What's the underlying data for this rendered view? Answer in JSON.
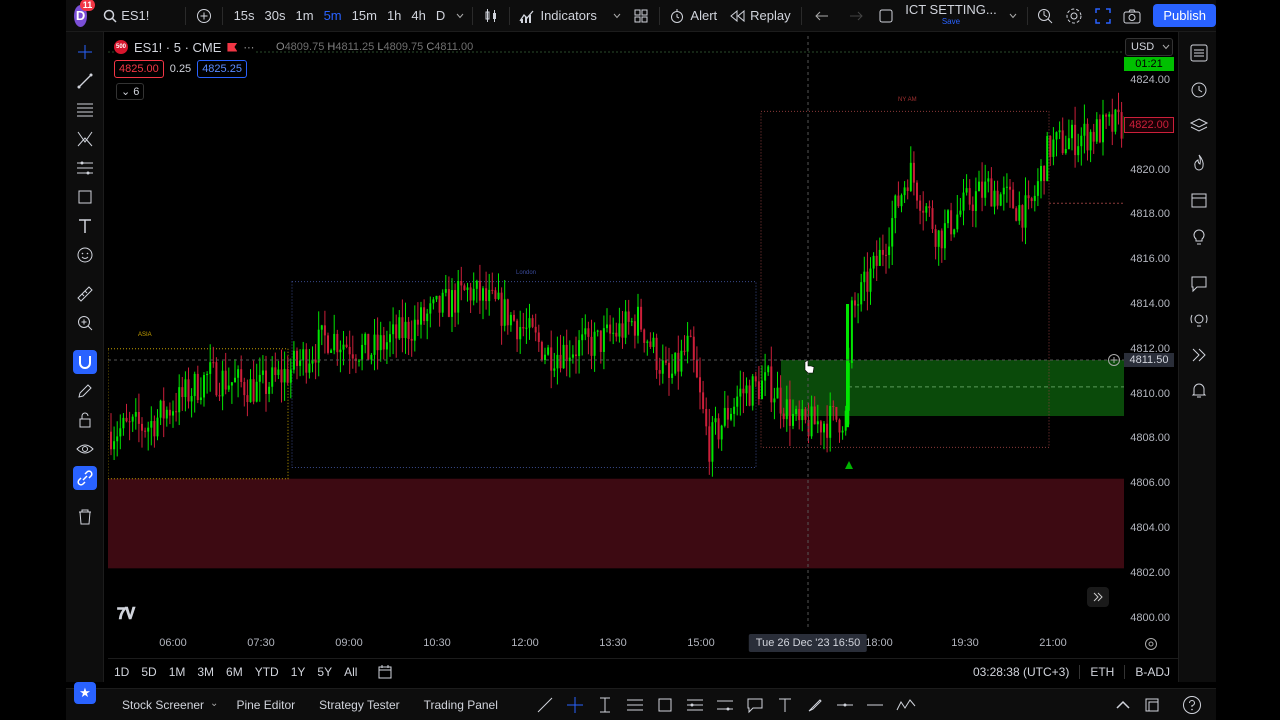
{
  "header": {
    "avatar_letter": "D",
    "notifications": "11",
    "symbol": "ES1!",
    "timeframes": [
      "15s",
      "30s",
      "1m",
      "5m",
      "15m",
      "1h",
      "4h",
      "D"
    ],
    "active_timeframe": "5m",
    "indicators_label": "Indicators",
    "alert_label": "Alert",
    "replay_label": "Replay",
    "layout_name": "ICT SETTING...",
    "layout_status": "Save",
    "publish_label": "Publish"
  },
  "legend": {
    "symbol_title": "ES1! · 5 · CME",
    "symbol_logo": "500",
    "ohlc": {
      "o": "4809.75",
      "h": "4811.25",
      "l": "4809.75",
      "c": "4811.00"
    },
    "sell_price": "4825.00",
    "spread": "0.25",
    "buy_price": "4825.25",
    "indicator_count": "6"
  },
  "price_axis": {
    "currency": "USD",
    "labels": [
      "4824.00",
      "4822.00",
      "4820.00",
      "4818.00",
      "4816.00",
      "4814.00",
      "4812.00",
      "4810.00",
      "4808.00",
      "4806.00",
      "4804.00",
      "4802.00",
      "4800.00"
    ],
    "values": [
      4824,
      4822,
      4820,
      4818,
      4816,
      4814,
      4812,
      4810,
      4808,
      4806,
      4804,
      4802,
      4800
    ],
    "current_price": "4822.00",
    "cursor_price": "4811.50",
    "countdown": "01:21"
  },
  "time_axis": {
    "labels": [
      "06:00",
      "07:30",
      "09:00",
      "10:30",
      "12:00",
      "13:30",
      "15:00",
      "18:00",
      "19:30",
      "21:00"
    ],
    "cursor_time": "Tue 26 Dec '23   16:50"
  },
  "sessions": {
    "asia": "ASIA",
    "london": "London",
    "ny_am": "NY AM"
  },
  "range_bar": {
    "ranges": [
      "1D",
      "5D",
      "1M",
      "3M",
      "6M",
      "YTD",
      "1Y",
      "5Y",
      "All"
    ],
    "clock": "03:28:38 (UTC+3)",
    "session": "ETH",
    "adjust": "B-ADJ"
  },
  "bottom_bar": {
    "tabs": [
      "Stock Screener",
      "Pine Editor",
      "Strategy Tester",
      "Trading Panel"
    ]
  },
  "colors": {
    "up": "#00e600",
    "down": "#cc1f3a",
    "accent": "#2962ff",
    "bull_zone": "#0a4a0a",
    "bear_zone": "#3d0a12"
  }
}
